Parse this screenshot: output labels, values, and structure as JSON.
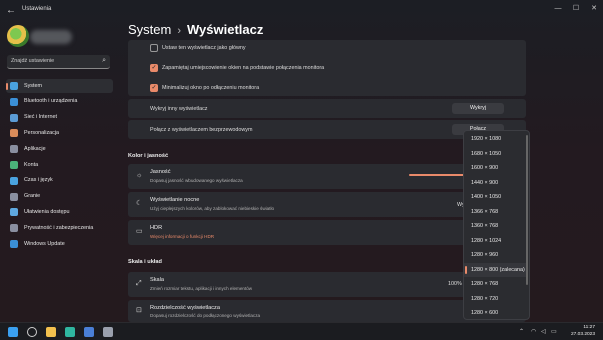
{
  "window": {
    "title": "Ustawienia",
    "controls": {
      "minimize": "—",
      "maximize": "☐",
      "close": "✕"
    },
    "back_icon": "←"
  },
  "sidebar": {
    "search_placeholder": "Znajdź ustawienie",
    "items": [
      {
        "label": "System",
        "icon": "monitor-icon",
        "color": "#4aa3df",
        "active": true
      },
      {
        "label": "Bluetooth i urządzenia",
        "icon": "bluetooth-icon",
        "color": "#3b8fd6"
      },
      {
        "label": "Sieć i Internet",
        "icon": "wifi-icon",
        "color": "#5b9bd5"
      },
      {
        "label": "Personalizacja",
        "icon": "brush-icon",
        "color": "#d98b5a"
      },
      {
        "label": "Aplikacje",
        "icon": "apps-icon",
        "color": "#8a8fa0"
      },
      {
        "label": "Konta",
        "icon": "person-icon",
        "color": "#4bb37a"
      },
      {
        "label": "Czas i język",
        "icon": "globe-icon",
        "color": "#4aa3df"
      },
      {
        "label": "Granie",
        "icon": "gamepad-icon",
        "color": "#8a8fa0"
      },
      {
        "label": "Ułatwienia dostępu",
        "icon": "accessibility-icon",
        "color": "#5fa8e0"
      },
      {
        "label": "Prywatność i zabezpieczenia",
        "icon": "shield-icon",
        "color": "#8a8fa0"
      },
      {
        "label": "Windows Update",
        "icon": "refresh-icon",
        "color": "#3b8fd6"
      }
    ]
  },
  "header": {
    "parent": "System",
    "separator": "›",
    "current": "Wyświetlacz"
  },
  "multi_display": {
    "checkboxes": [
      {
        "label": "Ustaw ten wyświetlacz jako główny",
        "checked": false
      },
      {
        "label": "Zapamiętaj umiejscowienie okien na podstawie połączenia monitora",
        "checked": true
      },
      {
        "label": "Minimalizuj okno po odłączeniu monitora",
        "checked": true
      }
    ],
    "detect_label": "Wykryj inny wyświetlacz",
    "detect_button": "Wykryj",
    "wireless_label": "Połącz z wyświetlaczem bezprzewodowym",
    "wireless_button": "Połącz"
  },
  "brightness_section": {
    "heading": "Kolor i jasność",
    "brightness_title": "Jasność",
    "brightness_sub": "Dopasuj jasność wbudowanego wyświetlacza",
    "night_title": "Wyświetlanie nocne",
    "night_sub": "Użyj cieplejszych kolorów, aby zablokować niebieskie światło",
    "night_value": "Wy",
    "hdr_title": "HDR",
    "hdr_link": "Więcej informacji o funkcji HDR"
  },
  "scale_section": {
    "heading": "Skala i układ",
    "scale_title": "Skala",
    "scale_sub": "Zmień rozmiar tekstu, aplikacji i innych elementów",
    "scale_value": "100%",
    "res_title": "Rozdzielczość wyświetlacza",
    "res_sub": "Dopasuj rozdzielczość do podłączonego wyświetlacza"
  },
  "resolution_dropdown": {
    "options": [
      "1920 × 1080",
      "1680 × 1050",
      "1600 × 900",
      "1440 × 900",
      "1400 × 1050",
      "1366 × 768",
      "1360 × 768",
      "1280 × 1024",
      "1280 × 960",
      "1280 × 800 (zalecana)",
      "1280 × 768",
      "1280 × 720",
      "1280 × 600"
    ],
    "selected_index": 9
  },
  "taskbar": {
    "icons": [
      "windows-start-icon",
      "search-icon",
      "file-explorer-icon",
      "edge-icon",
      "store-icon",
      "settings-icon"
    ],
    "time": "11:27",
    "date": "27.03.2023",
    "accent": "#e98a6a"
  }
}
